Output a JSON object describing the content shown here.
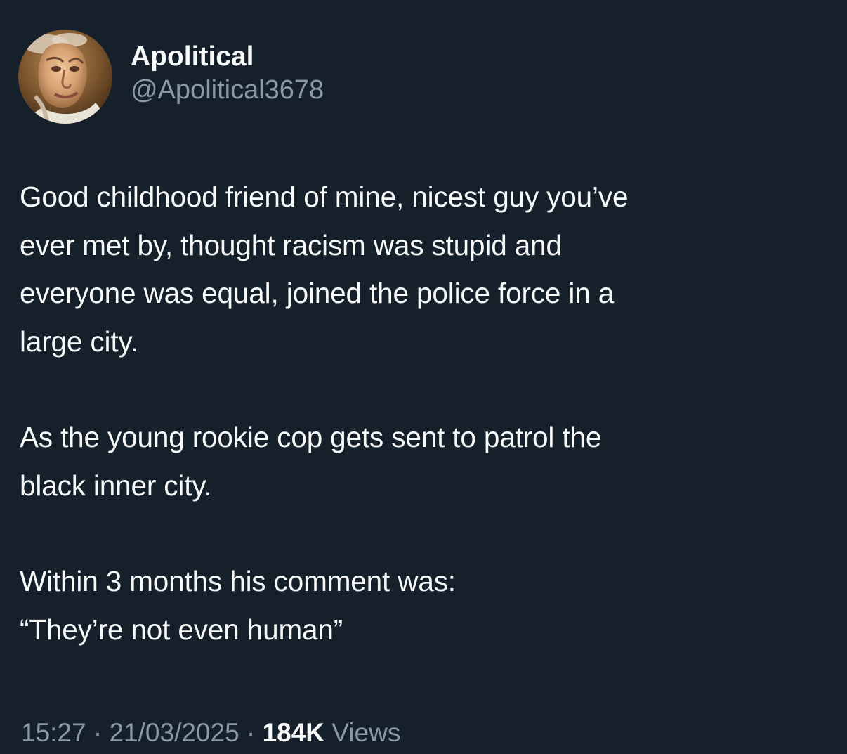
{
  "tweet": {
    "display_name": "Apolitical",
    "handle": "@Apolitical3678",
    "paragraphs": [
      "Good childhood friend of mine, nicest guy you’ve\never met by, thought racism was stupid and\neveryone was equal, joined the police force in a\nlarge city.",
      "As the young rookie cop gets sent to patrol the\nblack inner city.",
      "Within 3 months his comment was:\n“They’re not even human”"
    ],
    "time": "15:27",
    "separator": "·",
    "date": "21/03/2025",
    "views_count": "184K",
    "views_label": "Views"
  },
  "colors": {
    "background": "#15202b",
    "primary_text": "#f7f9f9",
    "secondary_text": "#8b98a5"
  },
  "icons": {
    "avatar": "portrait-avatar"
  }
}
